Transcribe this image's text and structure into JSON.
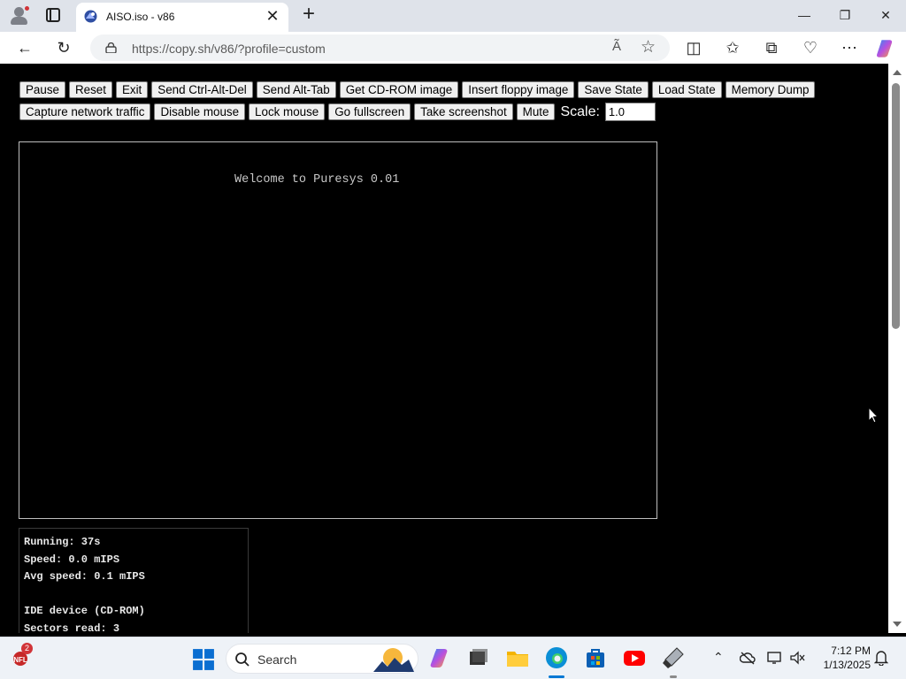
{
  "browser": {
    "tab_title": "AISO.iso - v86",
    "url": "https://copy.sh/v86/?profile=custom",
    "read_aloud_label": "Ã"
  },
  "toolbar_row1": [
    "Pause",
    "Reset",
    "Exit",
    "Send Ctrl-Alt-Del",
    "Send Alt-Tab",
    "Get CD-ROM image",
    "Insert floppy image",
    "Save State",
    "Load State",
    "Memory Dump"
  ],
  "toolbar_row2": [
    "Capture network traffic",
    "Disable mouse",
    "Lock mouse",
    "Go fullscreen",
    "Take screenshot",
    "Mute"
  ],
  "scale": {
    "label": "Scale:",
    "value": "1.0"
  },
  "screen": {
    "text": "Welcome to Puresys 0.01"
  },
  "stats": [
    "Running: 37s",
    "Speed: 0.0 mIPS",
    "Avg speed: 0.1 mIPS",
    "",
    "IDE device (CD-ROM)",
    "Sectors read: 3"
  ],
  "taskbar": {
    "weather_badge": "2",
    "search_placeholder": "Search",
    "time": "7:12 PM",
    "date": "1/13/2025"
  },
  "colors": {
    "accent_edge": "#0078d4",
    "page_bg": "#000000",
    "screen_text": "#c8c8c8"
  }
}
